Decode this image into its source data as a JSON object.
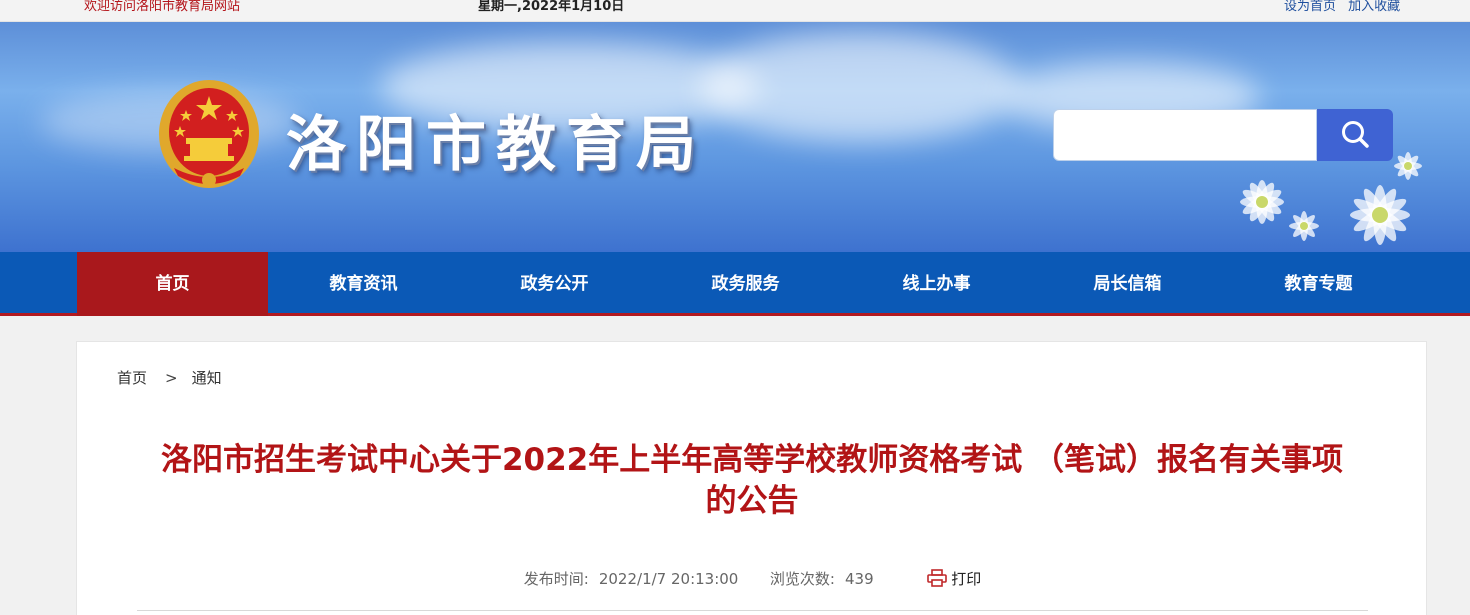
{
  "topbar": {
    "welcome": "欢迎访问洛阳市教育局网站",
    "date": "星期一,2022年1月10日",
    "set_home": "设为首页",
    "add_favorite": "加入收藏"
  },
  "header": {
    "site_title": "洛阳市教育局",
    "search_placeholder": "",
    "emblem_icon": "national-emblem-icon",
    "search_icon": "search-icon"
  },
  "nav": {
    "items": [
      {
        "label": "首页",
        "active": true
      },
      {
        "label": "教育资讯",
        "active": false
      },
      {
        "label": "政务公开",
        "active": false
      },
      {
        "label": "政务服务",
        "active": false
      },
      {
        "label": "线上办事",
        "active": false
      },
      {
        "label": "局长信箱",
        "active": false
      },
      {
        "label": "教育专题",
        "active": false
      }
    ]
  },
  "breadcrumb": {
    "home": "首页",
    "separator": ">",
    "current": "通知"
  },
  "article": {
    "title": "洛阳市招生考试中心关于2022年上半年高等学校教师资格考试 （笔试）报名有关事项的公告",
    "publish_label": "发布时间:",
    "publish_time": "2022/1/7 20:13:00",
    "views_label": "浏览次数:",
    "views": "439",
    "print_label": "打印",
    "print_icon": "printer-icon"
  },
  "colors": {
    "nav_bg": "#0b59b6",
    "nav_active": "#a9181c",
    "title_red": "#b21416",
    "search_button": "#3f63d3"
  }
}
